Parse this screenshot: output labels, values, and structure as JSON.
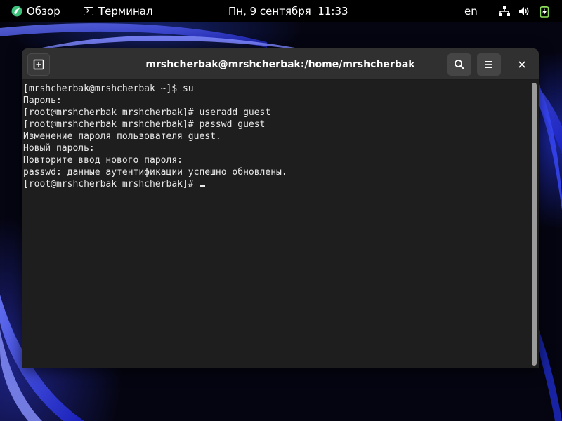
{
  "topbar": {
    "activities_label": "Обзор",
    "app_menu_label": "Терминал",
    "clock": "Пн, 9 сентября  11:33",
    "language": "en",
    "icons": [
      "network-icon",
      "volume-icon",
      "battery-icon"
    ]
  },
  "window": {
    "title": "mrshcherbak@mrshcherbak:/home/mrshcherbak",
    "buttons": [
      "new-tab-icon",
      "search-icon",
      "menu-icon",
      "close-icon"
    ]
  },
  "terminal": {
    "lines": [
      "[mrshcherbak@mrshcherbak ~]$ su",
      "Пароль:",
      "[root@mrshcherbak mrshcherbak]# useradd guest",
      "[root@mrshcherbak mrshcherbak]# passwd guest",
      "Изменение пароля пользователя guest.",
      "Новый пароль:",
      "Повторите ввод нового пароля:",
      "passwd: данные аутентификации успешно обновлены.",
      "[root@mrshcherbak mrshcherbak]# "
    ]
  },
  "colors": {
    "topbar_bg": "#000000",
    "headerbar_bg": "#303030",
    "terminal_bg": "#1e1e1e",
    "terminal_fg": "#e8e8e8",
    "logo_green": "#3cc27a",
    "battery_green": "#8ee05a",
    "wallpaper_blue": "#2838ff"
  }
}
